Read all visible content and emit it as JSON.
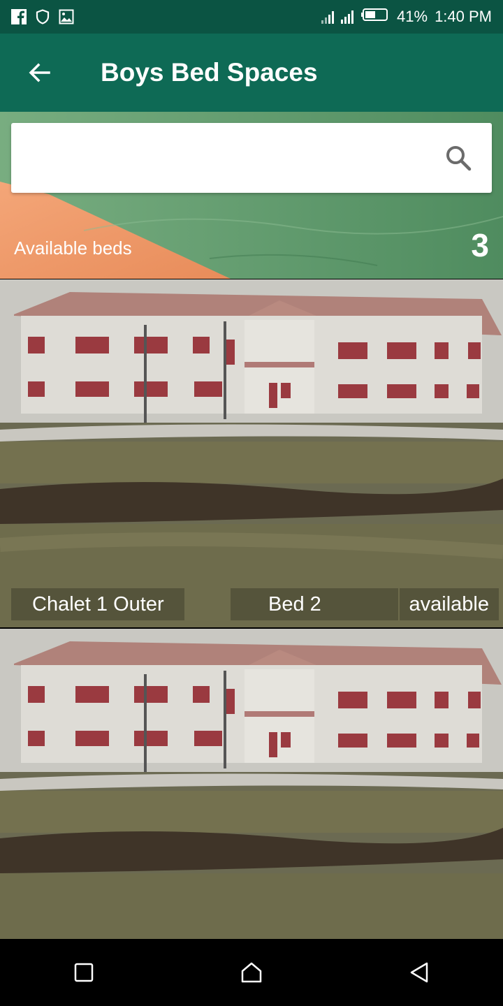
{
  "status_bar": {
    "battery": "41%",
    "time": "1:40 PM",
    "icons": [
      "facebook-icon",
      "shield-icon",
      "image-icon",
      "signal-icon",
      "battery-icon"
    ]
  },
  "app_bar": {
    "title": "Boys Bed Spaces",
    "back_icon": "arrow-left-icon"
  },
  "search": {
    "placeholder": "",
    "value": "",
    "icon": "search-icon"
  },
  "summary": {
    "label": "Available beds",
    "count": "3"
  },
  "beds": [
    {
      "location": "Chalet 1 Outer",
      "bed": "Bed 2",
      "status": "available"
    },
    {
      "location": "",
      "bed": "",
      "status": ""
    }
  ],
  "colors": {
    "status_bar": "#0b5443",
    "app_bar": "#0e6a55",
    "banner_green": "#5c9468",
    "banner_orange": "#f0a070"
  },
  "nav_bar": {
    "icons": [
      "square-recents-icon",
      "home-icon",
      "triangle-back-icon"
    ]
  }
}
